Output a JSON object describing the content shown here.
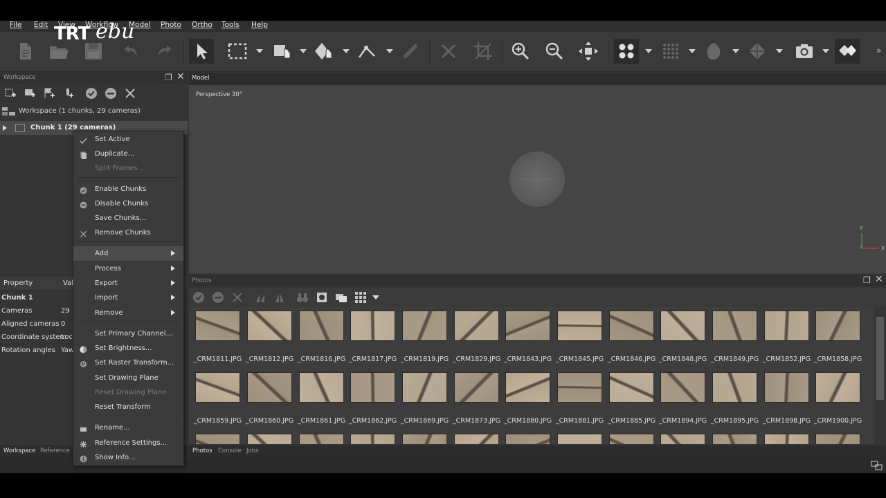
{
  "menubar": {
    "items": [
      "File",
      "Edit",
      "View",
      "Workflow",
      "Model",
      "Photo",
      "Ortho",
      "Tools",
      "Help"
    ]
  },
  "logo": {
    "text_a": "TRT",
    "text_b": "ebu"
  },
  "toolbar": {
    "icons": [
      "new-document-icon",
      "open-folder-icon",
      "save-icon",
      "undo-icon",
      "redo-icon",
      "navigation-arrow-icon",
      "rectangle-selection-icon",
      "move-object-icon",
      "rotate-object-icon",
      "ruler-icon",
      "delete-icon",
      "crop-icon",
      "zoom-in-icon",
      "zoom-out-icon",
      "reset-view-icon",
      "point-cloud-icon",
      "dense-cloud-icon",
      "model-view-icon",
      "tiled-model-icon",
      "camera-icon",
      "texture-icon"
    ],
    "more": "»"
  },
  "workspace": {
    "panel_title": "Workspace",
    "root_label": "Workspace (1 chunks, 29 cameras)",
    "chunk_label": "Chunk 1 (29 cameras)"
  },
  "property": {
    "col_property": "Property",
    "col_value": "Val",
    "section": "Chunk 1",
    "rows": [
      {
        "key": "Cameras",
        "value": "29"
      },
      {
        "key": "Aligned cameras",
        "value": "0"
      },
      {
        "key": "Coordinate system",
        "value": "Loc"
      },
      {
        "key": "Rotation angles",
        "value": "Yaw"
      }
    ]
  },
  "left_tabs": [
    "Workspace",
    "Reference"
  ],
  "model": {
    "tab": "Model",
    "view_label": "Perspective 30°",
    "axis_y": "Y",
    "axis_x": "X",
    "axis_z": "Z"
  },
  "photos": {
    "panel_title": "Photos",
    "row1": [
      "_CRM1811.JPG",
      "_CRM1812.JPG",
      "_CRM1816.JPG",
      "_CRM1817.JPG",
      "_CRM1819.JPG",
      "_CRM1829.JPG",
      "_CRM1843.JPG",
      "_CRM1845.JPG",
      "_CRM1846.JPG",
      "_CRM1848.JPG",
      "_CRM1849.JPG",
      "_CRM1852.JPG",
      "_CRM1858.JPG"
    ],
    "row2": [
      "_CRM1859.JPG",
      "_CRM1860.JPG",
      "_CRM1861.JPG",
      "_CRM1862.JPG",
      "_CRM1869.JPG",
      "_CRM1873.JPG",
      "_CRM1880.JPG",
      "_CRM1881.JPG",
      "_CRM1885.JPG",
      "_CRM1894.JPG",
      "_CRM1895.JPG",
      "_CRM1898.JPG",
      "_CRM1900.JPG"
    ]
  },
  "bottom_tabs": [
    "Photos",
    "Console",
    "Jobs"
  ],
  "context_menu": {
    "items": [
      {
        "label": "Set Active",
        "icon": "check-icon",
        "disabled": false
      },
      {
        "label": "Duplicate...",
        "icon": "duplicate-icon",
        "disabled": false
      },
      {
        "label": "Split Frames...",
        "icon": "",
        "disabled": true
      },
      {
        "label": "Enable Chunks",
        "icon": "enable-icon",
        "disabled": false
      },
      {
        "label": "Disable Chunks",
        "icon": "disable-icon",
        "disabled": false
      },
      {
        "label": "Save Chunks...",
        "icon": "",
        "disabled": false
      },
      {
        "label": "Remove Chunks",
        "icon": "remove-icon",
        "disabled": false
      },
      {
        "label": "Add",
        "icon": "",
        "disabled": false,
        "submenu": true
      },
      {
        "label": "Process",
        "icon": "",
        "disabled": false,
        "submenu": true
      },
      {
        "label": "Export",
        "icon": "",
        "disabled": false,
        "submenu": true
      },
      {
        "label": "Import",
        "icon": "",
        "disabled": false,
        "submenu": true
      },
      {
        "label": "Remove",
        "icon": "",
        "disabled": false,
        "submenu": true
      },
      {
        "label": "Set Primary Channel...",
        "icon": "",
        "disabled": false
      },
      {
        "label": "Set Brightness...",
        "icon": "brightness-icon",
        "disabled": false
      },
      {
        "label": "Set Raster Transform...",
        "icon": "raster-icon",
        "disabled": false
      },
      {
        "label": "Set Drawing Plane",
        "icon": "",
        "disabled": false
      },
      {
        "label": "Reset Drawing Plane",
        "icon": "",
        "disabled": true
      },
      {
        "label": "Reset Transform",
        "icon": "",
        "disabled": false
      },
      {
        "label": "Rename...",
        "icon": "rename-icon",
        "disabled": false
      },
      {
        "label": "Reference Settings...",
        "icon": "settings-icon",
        "disabled": false
      },
      {
        "label": "Show Info...",
        "icon": "info-icon",
        "disabled": false
      }
    ],
    "hovered": "Add"
  }
}
